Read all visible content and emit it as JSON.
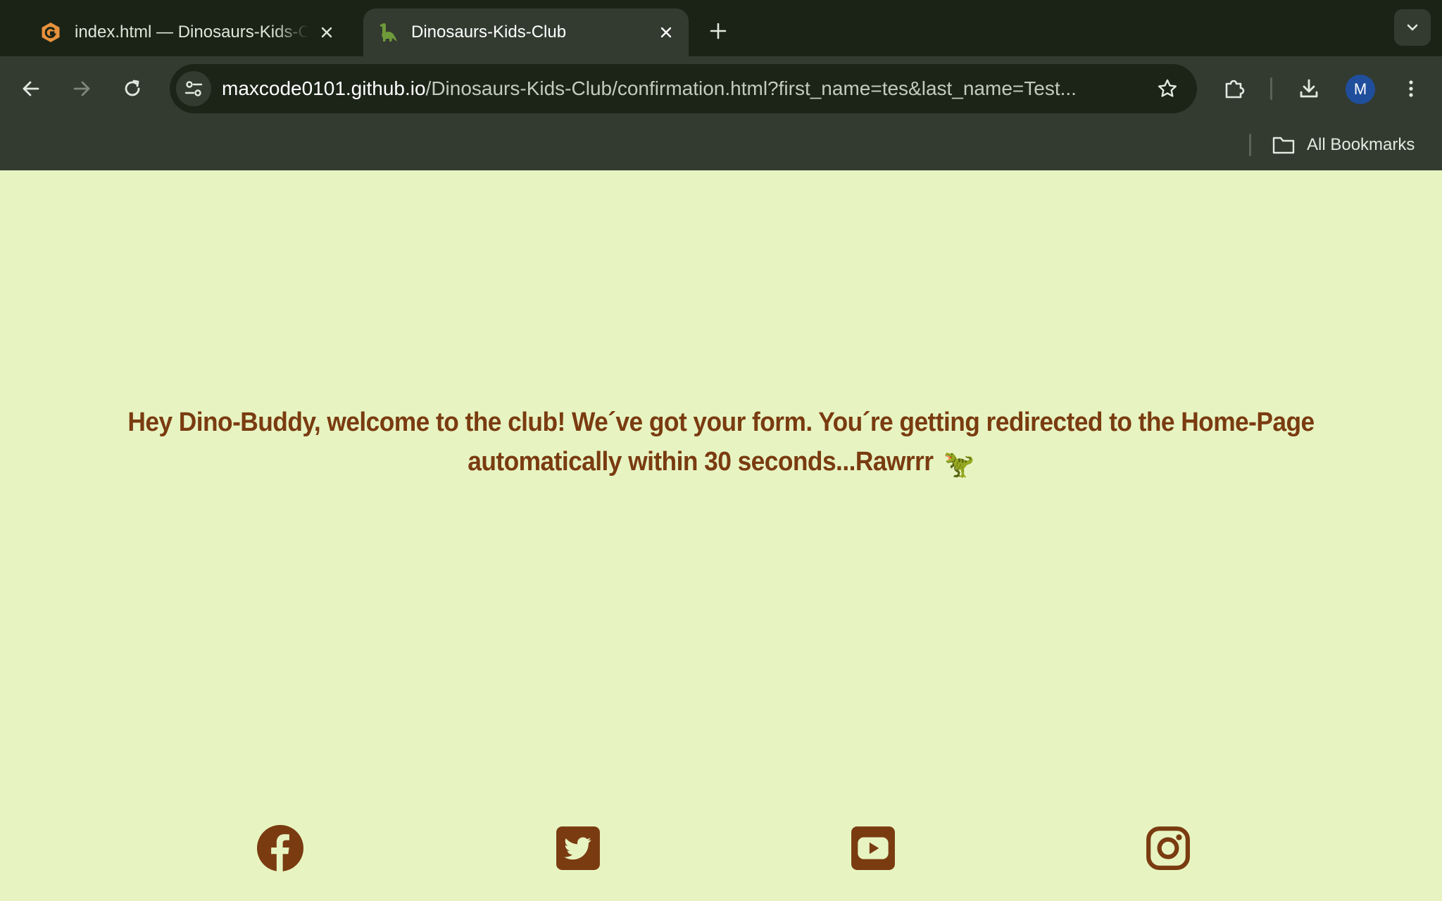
{
  "browser": {
    "tabs": [
      {
        "title": "index.html — Dinosaurs-Kids-Club",
        "favicon": "hexagon-g-icon",
        "active": false
      },
      {
        "title": "Dinosaurs-Kids-Club",
        "favicon": "dinosaur-icon",
        "active": true
      }
    ],
    "omnibox": {
      "url_host": "maxcode0101.github.io",
      "url_path": "/Dinosaurs-Kids-Club/confirmation.html?first_name=tes&last_name=Test..."
    },
    "profile_initial": "M",
    "bookmarks_label": "All Bookmarks"
  },
  "page": {
    "message": "Hey Dino-Buddy, welcome to the club! We´ve got your form. You´re getting redirected to the Home-Page automatically within 30 seconds...Rawrrr",
    "message_emoji": "🦖",
    "social_links": [
      "facebook-icon",
      "twitter-icon",
      "youtube-icon",
      "instagram-icon"
    ]
  },
  "colors": {
    "page_background": "#e7f4c2",
    "accent_brown": "#7a3b10",
    "chrome_dark": "#1a2316",
    "chrome_toolbar": "#333b30"
  }
}
